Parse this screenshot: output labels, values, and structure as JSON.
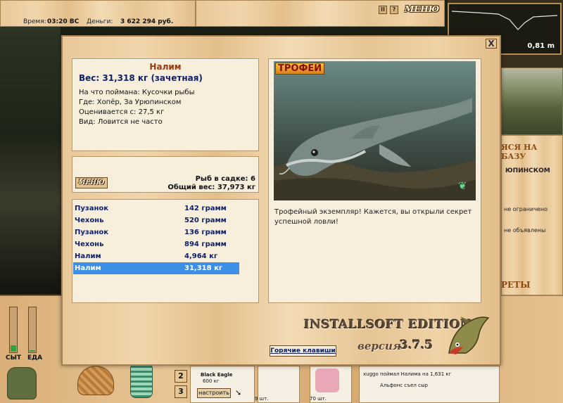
{
  "status_bar": {
    "time_label": "Время:",
    "time_value": "03:20 ВС",
    "money_label": "Деньги:",
    "money_value": "3 622 294 руб."
  },
  "top_controls": {
    "pause_label": "II",
    "help_label": "?",
    "menu_label": "МЕНЮ"
  },
  "depth": {
    "value": "0,81 m"
  },
  "side_panel": {
    "base_label": "ЯСЯ НА БАЗУ",
    "place": "ЮПИНСКОМ",
    "line1": "не ограничено",
    "line2": "",
    "line3": "не объявлены",
    "reports_label": "РЕТЫ"
  },
  "dialog": {
    "close_label": "X",
    "fish": {
      "name": "Налим",
      "weight": "Вес: 31,318 кг (зачетная)",
      "caught_with": "На что поймана: Кусочки рыбы",
      "caught_where": "Где: Хопёр, За Урюпинском",
      "valued_from": "Оценивается с: 27,5 кг",
      "kind": "Вид: Ловится не часто"
    },
    "keepnet": {
      "menu_label": "МЕНЮ",
      "fish_count": "Рыб в садке: 6",
      "total_weight": "Общий вес: 37,973 кг"
    },
    "catch_list": [
      {
        "name": "Пузанок",
        "weight": "142 грамм"
      },
      {
        "name": "Чехонь",
        "weight": "520 грамм"
      },
      {
        "name": "Пузанок",
        "weight": "136 грамм"
      },
      {
        "name": "Чехонь",
        "weight": "894 грамм"
      },
      {
        "name": "Налим",
        "weight": "4,964 кг"
      },
      {
        "name": "Налим",
        "weight": "31,318 кг"
      }
    ],
    "selected_index": 5,
    "trophy_badge": "ТРОФЕЙ",
    "trophy_text": "Трофейный экземпляр! Кажется, вы открыли секрет успешной ловли!",
    "edition": "INSTALLSOFT EDITION",
    "version_label": "версия",
    "version_number": "3.7.5",
    "hotkeys_label": "Горячие клавиши"
  },
  "bottom": {
    "gauge_sda_label": "СЫТ",
    "gauge_eda_label": "ЕДА",
    "gauge_sda_level": 0.15,
    "gauge_eda_level": 0.03,
    "slot2_label": "2",
    "slot3_label": "3",
    "rod_name": "Black Eagle",
    "rod_weight": "600 кг",
    "setup_label": "настроить",
    "lure_count": "9 шт.",
    "bait_count": "70 шт.",
    "chat_line1": "xuggo поймал Налима на 1,631 кг",
    "chat_line2": "Альфонс съел сыр"
  },
  "colors": {
    "accent_blue": "#10206a",
    "selection": "#3d8ee6",
    "fish_title": "#9a3a10",
    "gauge_fill": "#2ea23e"
  },
  "icons": [
    "close-icon",
    "butterfly-icon",
    "pike-logo-icon",
    "arrow-icon",
    "pause-icon",
    "help-icon"
  ]
}
